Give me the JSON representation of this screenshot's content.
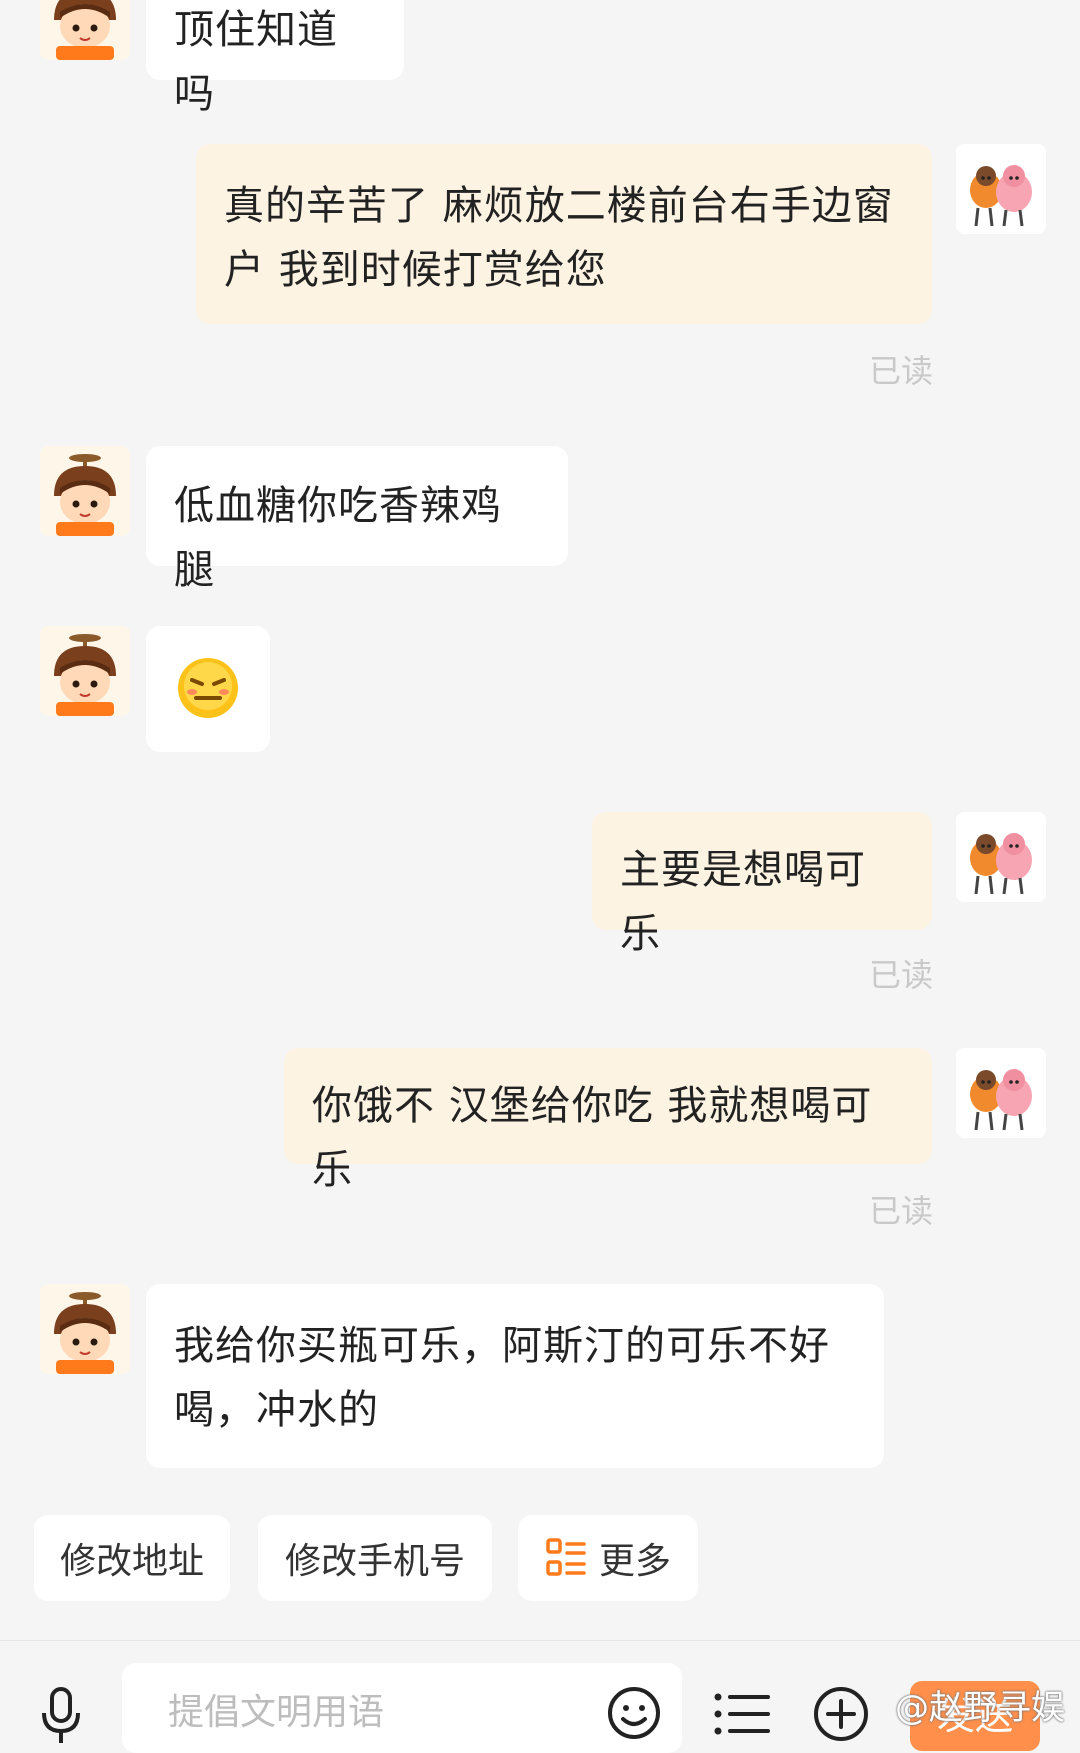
{
  "messages": [
    {
      "side": "in",
      "text": "顶住知道吗"
    },
    {
      "side": "out",
      "lines": [
        "真的辛苦了 麻烦放二楼前台右手边窗",
        "户 我到时候打赏给您"
      ],
      "status": "已读"
    },
    {
      "side": "in",
      "text": "低血糖你吃香辣鸡腿"
    },
    {
      "side": "in",
      "emoji": "embarrassed-emoji"
    },
    {
      "side": "out",
      "text": "主要是想喝可乐",
      "status": "已读"
    },
    {
      "side": "out",
      "text": "你饿不 汉堡给你吃 我就想喝可乐",
      "status": "已读"
    },
    {
      "side": "in",
      "lines": [
        "我给你买瓶可乐，阿斯汀的可乐不好",
        "喝，冲水的"
      ]
    }
  ],
  "quick_actions": {
    "modify_address": "修改地址",
    "modify_phone": "修改手机号",
    "more": "更多"
  },
  "input": {
    "placeholder": "提倡文明用语"
  },
  "send_label": "发送",
  "watermark": "@赵野寻娱",
  "icons": {
    "voice": "microphone-icon",
    "emoji": "smiley-icon",
    "list": "list-icon",
    "add": "plus-circle-icon",
    "more": "grid-menu-icon"
  },
  "colors": {
    "incoming_bubble": "#ffffff",
    "outgoing_bubble": "#fdf3e2",
    "accent": "#ff8f4a",
    "read_status": "#c9c9c9"
  }
}
